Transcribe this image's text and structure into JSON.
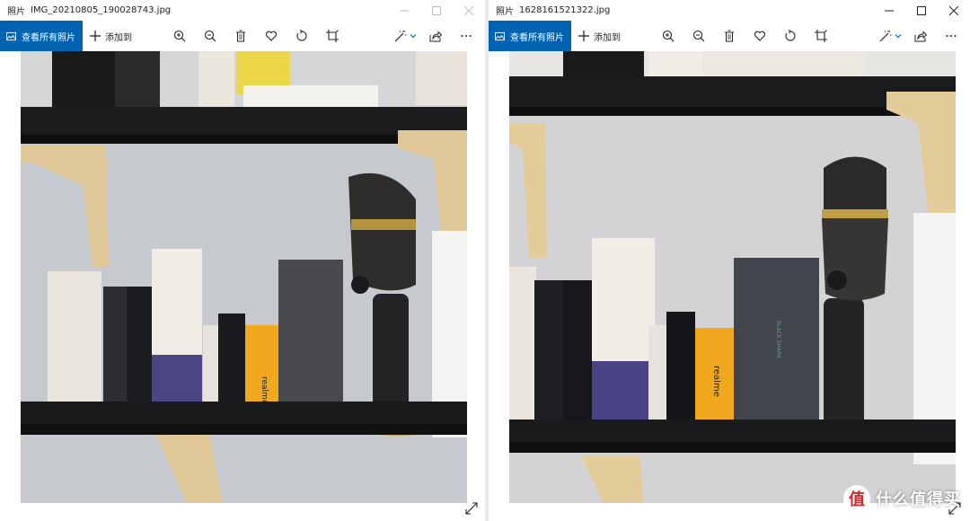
{
  "app": {
    "name": "照片"
  },
  "windows": {
    "left": {
      "filename": "IMG_20210805_190028743.jpg"
    },
    "right": {
      "filename": "1628161521322.jpg"
    }
  },
  "toolbar": {
    "view_all_label": "查看所有照片",
    "add_to_label": "添加到",
    "tool_icons": [
      "zoom-in-icon",
      "zoom-out-icon",
      "delete-icon",
      "favorite-icon",
      "rotate-icon",
      "crop-icon"
    ],
    "right_icons": [
      "enhance-icon",
      "share-icon",
      "more-icon"
    ]
  },
  "photo_text": {
    "product_label_left": "realme",
    "product_label_right": "realme",
    "box_label": "BLACK SHARK"
  },
  "watermark": {
    "logo": "值",
    "text": "什么值得买"
  },
  "colors": {
    "accent": "#0063b1",
    "wall": "#c9ccd0",
    "shelf": "#1c1c1e",
    "bracket": "#e0c898",
    "mic_gold": "#c9a84c",
    "product_yellow": "#f2a81e"
  }
}
